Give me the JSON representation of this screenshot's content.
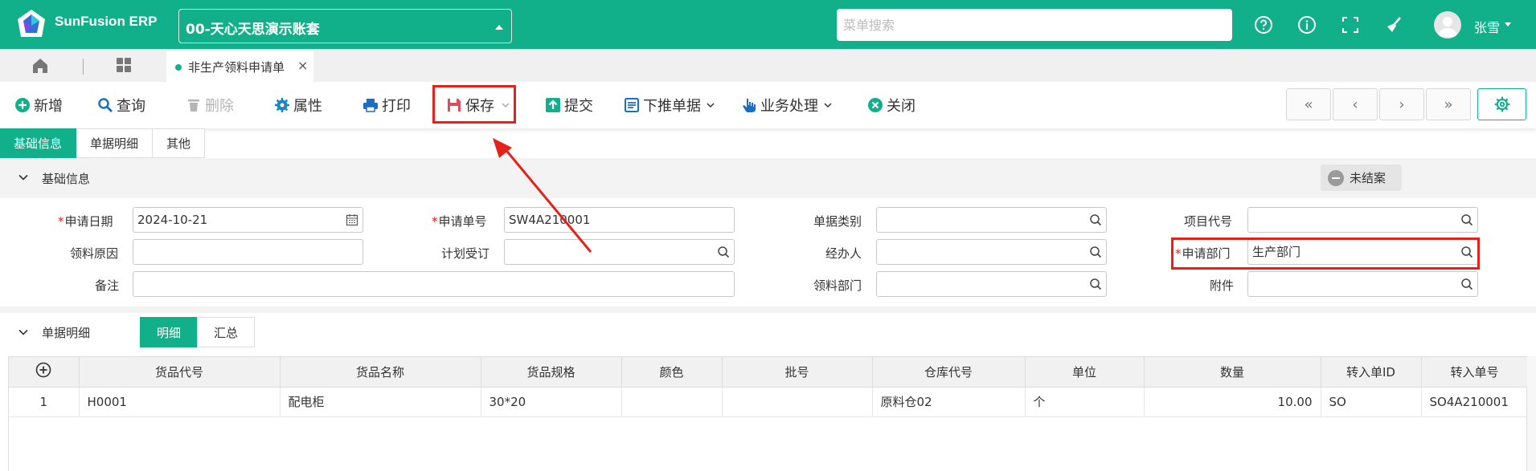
{
  "app": {
    "brand": "SunFusion ERP",
    "account": "00-天心天思演示账套"
  },
  "header": {
    "search_placeholder": "菜单搜索",
    "icons": [
      "help-icon",
      "info-icon",
      "fullscreen-icon",
      "broom-icon"
    ],
    "user_name": "张雪"
  },
  "tabs": {
    "active_tab": "非生产领料申请单",
    "close": "×"
  },
  "toolbar": {
    "add": "新增",
    "query": "查询",
    "delete": "删除",
    "attributes": "属性",
    "print": "打印",
    "save": "保存",
    "submit": "提交",
    "push_down": "下推单据",
    "business": "业务处理",
    "close": "关闭"
  },
  "pager": {
    "first": "«",
    "prev": "‹",
    "next": "›",
    "last": "»"
  },
  "section_tabs": [
    "基础信息",
    "单据明细",
    "其他"
  ],
  "basic": {
    "title": "基础信息",
    "status": "未结案"
  },
  "form": {
    "apply_date_label": "申请日期",
    "apply_date": "2024-10-21",
    "apply_no_label": "申请单号",
    "apply_no": "SW4A210001",
    "doc_type_label": "单据类别",
    "doc_type": "",
    "project_code_label": "项目代号",
    "project_code": "",
    "reason_label": "领料原因",
    "reason": "",
    "plan_order_label": "计划受订",
    "plan_order": "",
    "handler_label": "经办人",
    "handler": "",
    "apply_dept_label": "申请部门",
    "apply_dept": "生产部门",
    "remark_label": "备注",
    "remark": "",
    "pick_dept_label": "领料部门",
    "pick_dept": "",
    "attachment_label": "附件",
    "attachment": ""
  },
  "detail": {
    "title": "单据明细",
    "tabs": [
      "明细",
      "汇总"
    ],
    "columns": [
      "货品代号",
      "货品名称",
      "货品规格",
      "颜色",
      "批号",
      "仓库代号",
      "单位",
      "数量",
      "转入单ID",
      "转入单号"
    ],
    "rows": [
      {
        "index": "1",
        "code": "H0001",
        "name": "配电柜",
        "spec": "30*20",
        "color": "",
        "batch": "",
        "warehouse": "原料仓02",
        "unit": "个",
        "qty": "10.00",
        "src_id": "SO",
        "src_no": "SO4A210001"
      }
    ]
  },
  "colors": {
    "brand": "#12b08a",
    "highlight": "#e8201a",
    "required": "#e8201a"
  }
}
